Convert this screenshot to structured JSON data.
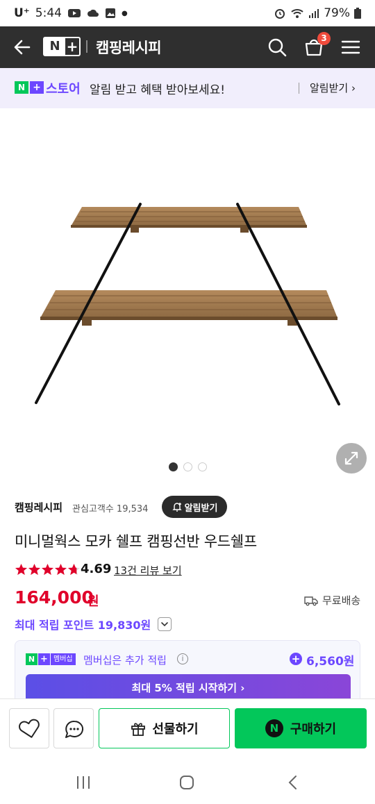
{
  "status_bar": {
    "carrier": "U⁺",
    "time": "5:44",
    "battery": "79%"
  },
  "header": {
    "logo_n": "N",
    "logo_plus": "+",
    "store_name": "캠핑레시피",
    "cart_count": "3"
  },
  "banner": {
    "badge_n": "N",
    "badge_plus": "+",
    "store_label": "스토어",
    "message": "알림 받고 혜택 받아보세요!",
    "action": "알림받기 ›"
  },
  "seller": {
    "name": "캠핑레시피",
    "watchers": "관심고객수 19,534",
    "alarm_button": "알림받기"
  },
  "product": {
    "title": "미니멀웍스 모카 쉘프 캠핑선반 우드쉘프",
    "rating": "4.69",
    "rating_value": 4.69,
    "review_link": "13건 리뷰 보기",
    "price": "164,000",
    "price_unit": "원",
    "shipping": "무료배송",
    "points": "최대 적립 포인트 19,830원",
    "image_page": 1,
    "image_count": 3
  },
  "membership": {
    "badge_n": "N",
    "badge_plus": "+",
    "badge_text": "멤버십",
    "text": "멤버십은 추가 적립",
    "amount": "6,560원",
    "cta": "최대 5% 적립 시작하기 ›"
  },
  "action_bar": {
    "gift_label": "선물하기",
    "buy_label": "구매하기",
    "buy_icon": "N"
  },
  "colors": {
    "naver_green": "#03c75a",
    "purple": "#6c47ff",
    "price_red": "#e0002a",
    "header_bg": "#2f2f2f"
  }
}
